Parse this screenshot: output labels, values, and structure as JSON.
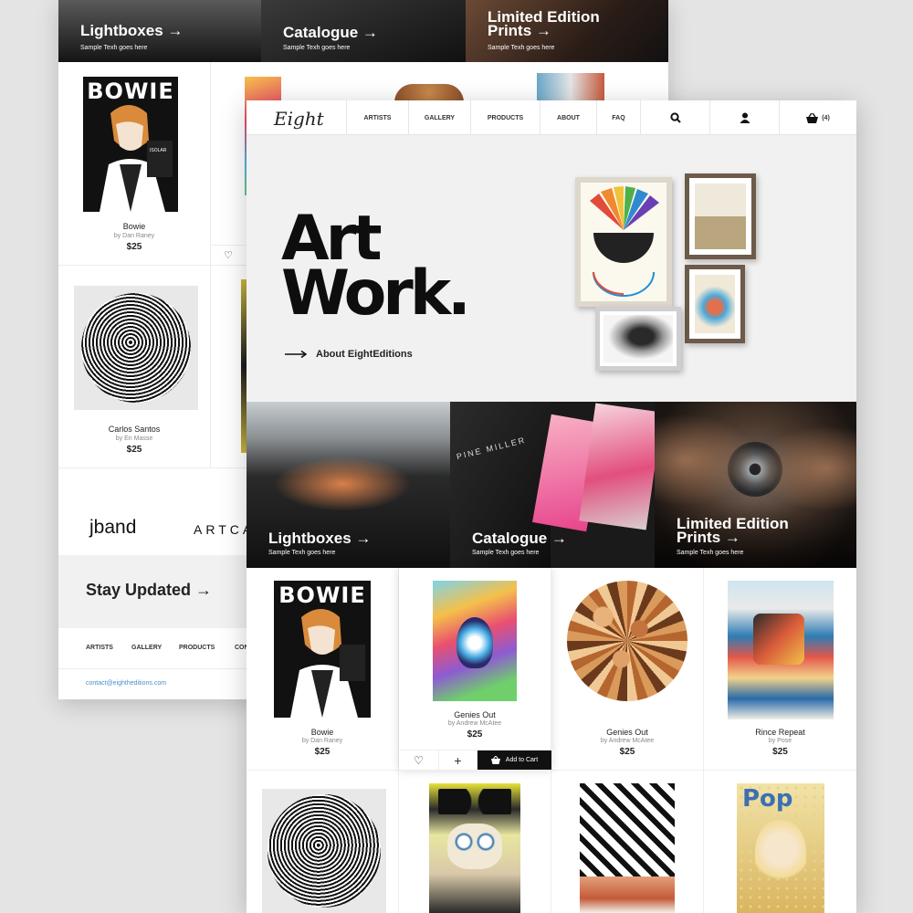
{
  "back": {
    "promos": [
      {
        "title": "Lightboxes →",
        "sub": "Sample Texh goes here"
      },
      {
        "title": "Catalogue →",
        "sub": "Sample Texh goes here"
      },
      {
        "title": "Limited Edition Prints →",
        "sub": "Sample Texh goes here"
      }
    ],
    "products": [
      {
        "name": "Bowie",
        "by": "by Dan Raney",
        "price": "$25"
      },
      {
        "name": "Carlos Santos",
        "by": "by En Masse",
        "price": "$25"
      }
    ],
    "logos": [
      "jband",
      "ARTCA"
    ],
    "stay_updated": "Stay Updated →",
    "footer_nav": [
      "ARTISTS",
      "GALLERY",
      "PRODUCTS",
      "CON"
    ],
    "contact": "contact@eightheditions.com"
  },
  "front": {
    "logo": "Eight",
    "nav": [
      "ARTISTS",
      "GALLERY",
      "PRODUCTS",
      "ABOUT",
      "FAQ"
    ],
    "cart_count": "(4)",
    "hero": {
      "title_line1": "Art",
      "title_line2": "Work.",
      "link": "About EightEditions"
    },
    "promos": [
      {
        "title": "Lightboxes →",
        "sub": "Sample Texh goes here"
      },
      {
        "title": "Catalogue →",
        "sub": "Sample Texh goes here"
      },
      {
        "title_line1": "Limited Edition",
        "title_line2": "Prints →",
        "sub": "Sample Texh goes here"
      }
    ],
    "promo_book_text": "PINE MILLER",
    "products": [
      {
        "name": "Bowie",
        "by": "by Dan Raney",
        "price": "$25"
      },
      {
        "name": "Genies Out",
        "by": "by Andrew McAtee",
        "price": "$25"
      },
      {
        "name": "Genies Out",
        "by": "by Andrew McAtee",
        "price": "$25"
      },
      {
        "name": "Rince Repeat",
        "by": "by Pose",
        "price": "$25"
      }
    ],
    "add_to_cart": "Add to Cart",
    "poster_bowie_title": "BOWIE",
    "poster_pop_title": "Pop"
  },
  "colors": {
    "accent": "#4a90c8",
    "dark": "#111111",
    "hero_bg": "#f1f1f1"
  }
}
